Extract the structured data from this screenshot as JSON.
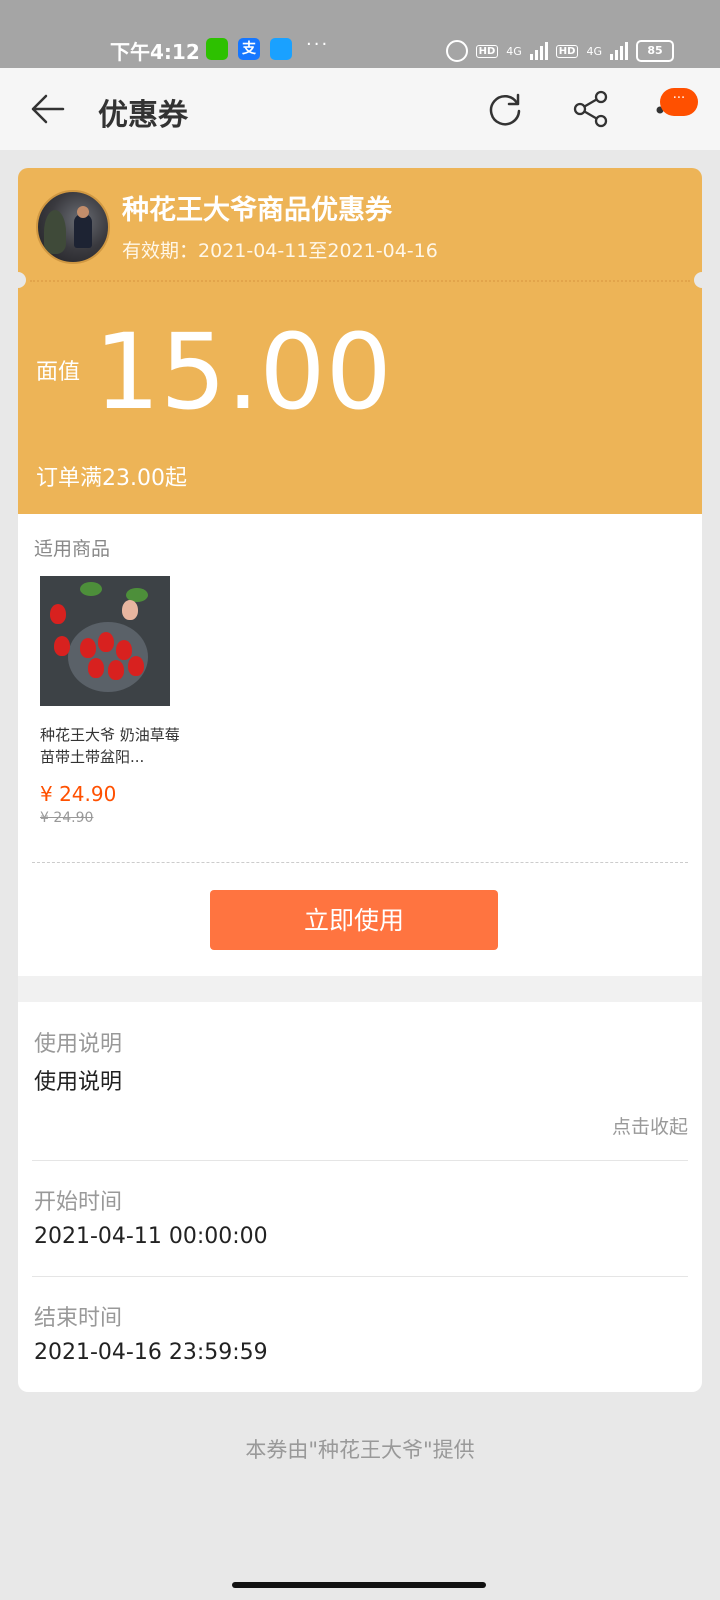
{
  "status_bar": {
    "time": "下午4:12",
    "alipay_glyph": "支",
    "more": "···",
    "hd1": "HD",
    "hd2": "HD",
    "net1": "4G",
    "net2": "4G",
    "battery": "85"
  },
  "header": {
    "title": "优惠券",
    "badge": "···"
  },
  "coupon": {
    "shop_title": "种花王大爷商品优惠券",
    "validity": "有效期：2021-04-11至2021-04-16",
    "face_label": "面值",
    "face_value": "15.00",
    "threshold": "订单满23.00起"
  },
  "products": {
    "section_label": "适用商品",
    "items": [
      {
        "name": "种花王大爷 奶油草莓苗带土带盆阳...",
        "price": "¥ 24.90",
        "original_price": "¥ 24.90"
      }
    ],
    "use_button": "立即使用"
  },
  "info": {
    "usage_label": "使用说明",
    "usage_value": "使用说明",
    "collapse": "点击收起",
    "start_label": "开始时间",
    "start_value": "2021-04-11 00:00:00",
    "end_label": "结束时间",
    "end_value": "2021-04-16 23:59:59"
  },
  "footer": "本券由\"种花王大爷\"提供",
  "colors": {
    "coupon_bg": "#edb457",
    "accent": "#ff5000",
    "button": "#ff7440"
  }
}
